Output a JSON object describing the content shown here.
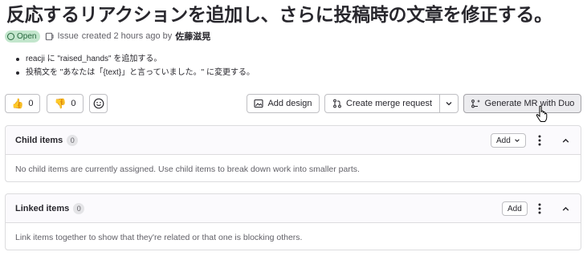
{
  "issue": {
    "title": "反応するリアクションを追加し、さらに投稿時の文章を修正する。",
    "status": "Open",
    "type_label": "Issue",
    "created_text": "created 2 hours ago by",
    "author": "佐藤滋晃"
  },
  "description": {
    "items": [
      "reacji に \"raised_hands\" を追加する。",
      "投稿文を \"あなたは「{text}」と言っていました。\" に変更する。"
    ]
  },
  "actions": {
    "thumbs_up_count": "0",
    "thumbs_down_count": "0",
    "add_design": "Add design",
    "create_merge_request": "Create merge request",
    "generate_mr": "Generate MR with Duo"
  },
  "child_items": {
    "title": "Child items",
    "count": "0",
    "add_label": "Add",
    "empty_text": "No child items are currently assigned. Use child items to break down work into smaller parts."
  },
  "linked_items": {
    "title": "Linked items",
    "count": "0",
    "add_label": "Add",
    "empty_text": "Link items together to show that they're related or that one is blocking others."
  },
  "colors": {
    "open_badge_bg": "#c3e6cd",
    "open_badge_text": "#24663b",
    "border": "#dcdcde"
  }
}
